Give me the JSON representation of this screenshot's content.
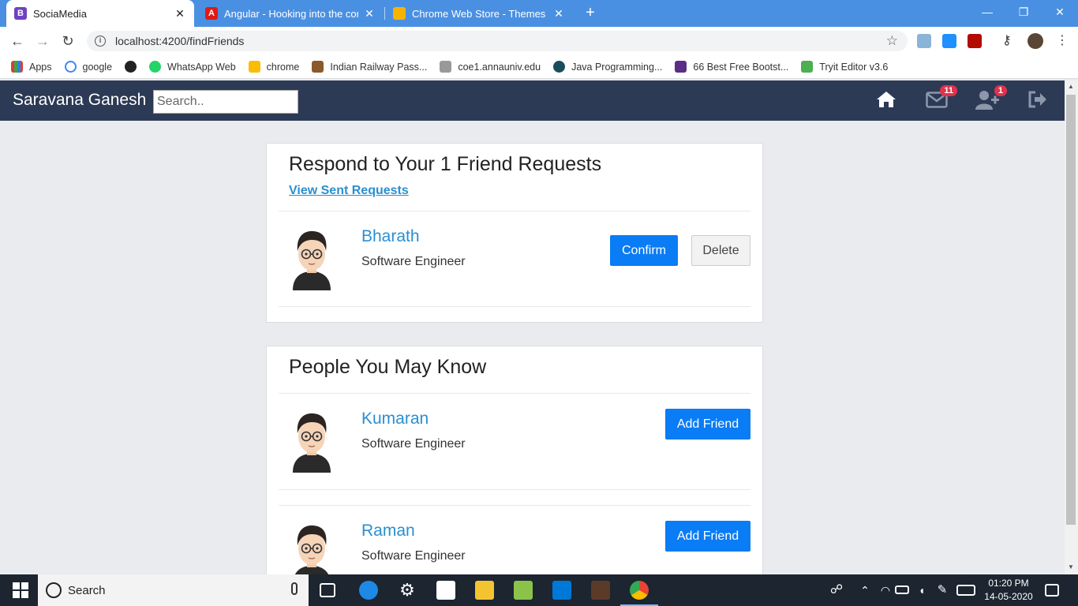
{
  "browser": {
    "tabs": [
      {
        "title": "SociaMedia",
        "favicon": "B",
        "favicon_color": "#6f42c1"
      },
      {
        "title": "Angular - Hooking into the comp",
        "favicon": "A",
        "favicon_color": "#dd1b16"
      },
      {
        "title": "Chrome Web Store - Themes",
        "favicon": "",
        "favicon_color": "#f4b400"
      }
    ],
    "url": "localhost:4200/findFriends",
    "bookmarks": [
      "Apps",
      "google",
      "",
      "WhatsApp Web",
      "chrome",
      "Indian Railway Pass...",
      "coe1.annauniv.edu",
      "Java Programming...",
      "66 Best Free Bootst...",
      "Tryit Editor v3.6"
    ]
  },
  "app": {
    "brand": "Saravana Ganesh",
    "search_placeholder": "Search..",
    "messages_badge": "11",
    "requests_badge": "1"
  },
  "requests": {
    "heading": "Respond to Your 1 Friend Requests",
    "link": "View Sent Requests",
    "items": [
      {
        "name": "Bharath",
        "role": "Software Engineer",
        "confirm": "Confirm",
        "delete": "Delete"
      }
    ]
  },
  "suggestions": {
    "heading": "People You May Know",
    "items": [
      {
        "name": "Kumaran",
        "role": "Software Engineer",
        "action": "Add Friend"
      },
      {
        "name": "Raman",
        "role": "Software Engineer",
        "action": "Add Friend"
      }
    ]
  },
  "taskbar": {
    "search_label": "Search",
    "time": "01:20 PM",
    "date": "14-05-2020"
  },
  "colors": {
    "primary": "#0a7cf5",
    "navbar": "#2d3a55",
    "link": "#2a8fd0",
    "badge": "#e0334b"
  }
}
